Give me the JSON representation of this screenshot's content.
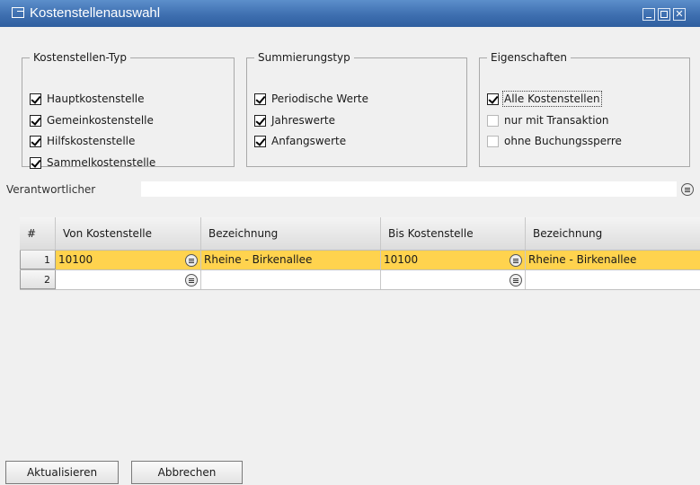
{
  "window": {
    "title": "Kostenstellenauswahl"
  },
  "groups": {
    "type": {
      "legend": "Kostenstellen-Typ",
      "items": [
        {
          "label": "Hauptkostenstelle",
          "checked": true
        },
        {
          "label": "Gemeinkostenstelle",
          "checked": true
        },
        {
          "label": "Hilfskostenstelle",
          "checked": true
        },
        {
          "label": "Sammelkostenstelle",
          "checked": true
        }
      ]
    },
    "summation": {
      "legend": "Summierungstyp",
      "items": [
        {
          "label": "Periodische Werte",
          "checked": true
        },
        {
          "label": "Jahreswerte",
          "checked": true
        },
        {
          "label": "Anfangswerte",
          "checked": true
        }
      ]
    },
    "properties": {
      "legend": "Eigenschaften",
      "items": [
        {
          "label": "Alle Kostenstellen",
          "checked": true
        },
        {
          "label": "nur mit Transaktion",
          "checked": false
        },
        {
          "label": "ohne Buchungssperre",
          "checked": false
        }
      ]
    }
  },
  "responsible": {
    "label": "Verantwortlicher",
    "value": ""
  },
  "grid": {
    "headers": [
      "#",
      "Von Kostenstelle",
      "Bezeichnung",
      "Bis Kostenstelle",
      "Bezeichnung"
    ],
    "rows": [
      {
        "num": "1",
        "von": "10100",
        "von_desc": "Rheine - Birkenallee",
        "bis": "10100",
        "bis_desc": "Rheine - Birkenallee",
        "selected": true
      },
      {
        "num": "2",
        "von": "",
        "von_desc": "",
        "bis": "",
        "bis_desc": "",
        "selected": false
      }
    ]
  },
  "buttons": {
    "update": "Aktualisieren",
    "cancel": "Abbrechen"
  }
}
